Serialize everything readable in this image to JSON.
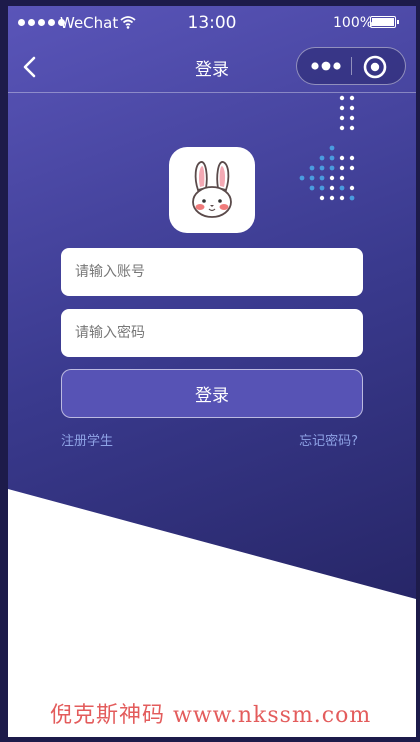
{
  "status_bar": {
    "carrier": "WeChat",
    "time": "13:00",
    "battery": "100%"
  },
  "nav": {
    "title": "登录",
    "icons": {
      "back": "chevron-left-icon",
      "more": "more-dots-icon",
      "close": "target-circle-icon"
    }
  },
  "form": {
    "account_placeholder": "请输入账号",
    "password_placeholder": "请输入密码",
    "login_label": "登录",
    "register_link": "注册学生",
    "forgot_link": "忘记密码?"
  },
  "logo": {
    "icon": "rabbit-icon"
  },
  "watermark": {
    "text": "倪克斯神码 www.nkssm.com"
  },
  "colors": {
    "gradient_top": "#5a55b9",
    "gradient_bottom": "#1f1e58",
    "button": "#5753b5",
    "link": "#8fa3e6",
    "dot_blue": "#4a9ce0",
    "watermark": "#dd3838"
  }
}
